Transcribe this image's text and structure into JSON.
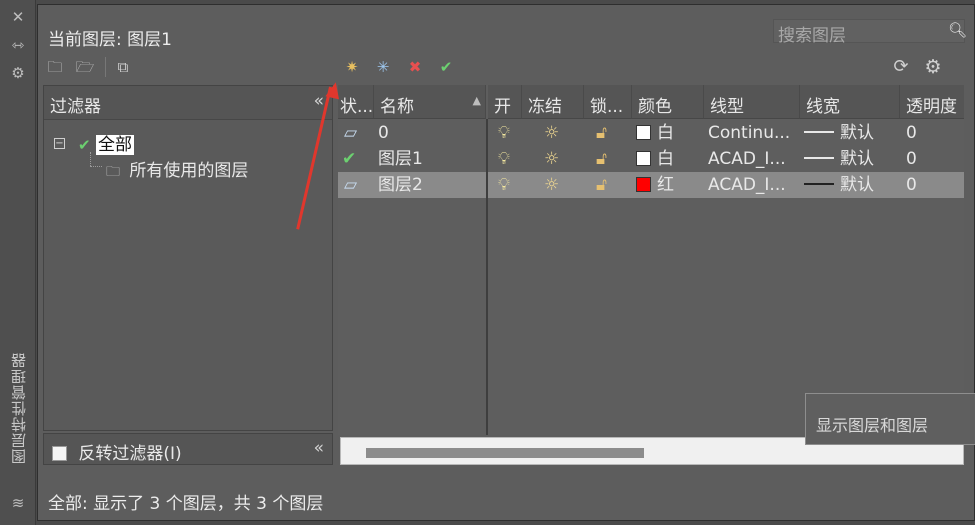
{
  "strip": {
    "title": "图层特性管理器"
  },
  "header": {
    "current_layer_text": "当前图层: 图层1",
    "search_placeholder": "搜索图层"
  },
  "filters": {
    "title": "过滤器",
    "tree": [
      {
        "label": "全部",
        "selected": true
      },
      {
        "label": "所有使用的图层"
      }
    ],
    "invert_label": "反转过滤器(I)"
  },
  "table": {
    "columns": [
      "状...",
      "名称",
      "开",
      "冻结",
      "锁...",
      "颜色",
      "线型",
      "线宽",
      "透明度"
    ],
    "rows": [
      {
        "status": "parallelogram-icon",
        "name": "0",
        "color_name": "白",
        "color_hex": "#ffffff",
        "linetype": "Continu...",
        "lineweight": "默认",
        "transparency": "0"
      },
      {
        "status": "check-icon",
        "name": "图层1",
        "color_name": "白",
        "color_hex": "#ffffff",
        "linetype": "ACAD_I...",
        "lineweight": "默认",
        "transparency": "0"
      },
      {
        "status": "parallelogram-icon",
        "name": "图层2",
        "color_name": "红",
        "color_hex": "#ff0000",
        "linetype": "ACAD_I...",
        "lineweight": "默认",
        "transparency": "0",
        "selected": true
      }
    ]
  },
  "tooltip": "显示图层和图层",
  "status_text": "全部: 显示了 3 个图层，共 3 个图层"
}
